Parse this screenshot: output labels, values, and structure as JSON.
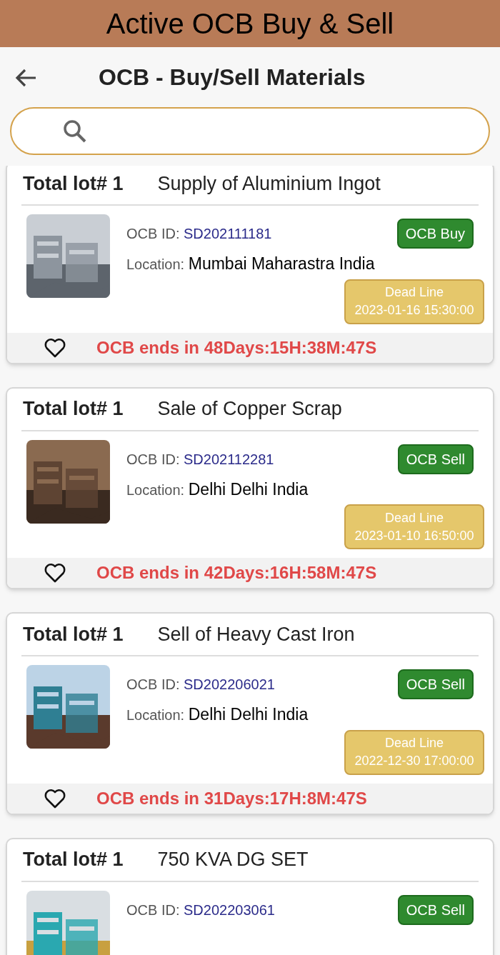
{
  "banner": {
    "title": "Active OCB Buy & Sell"
  },
  "app_bar": {
    "title": "OCB - Buy/Sell Materials"
  },
  "lots": [
    {
      "lot": "Total lot# 1",
      "name": "Supply of Aluminium Ingot",
      "id_label": "OCB ID:",
      "id": "SD202111181",
      "location_label": "Location:",
      "location": "Mumbai Maharastra India",
      "type": "OCB Buy",
      "deadline_label": "Dead Line",
      "deadline": "2023-01-16 15:30:00",
      "countdown": "OCB ends in 48Days:15H:38M:47S",
      "favorite": false
    },
    {
      "lot": "Total lot# 1",
      "name": "Sale of Copper Scrap",
      "id_label": "OCB ID:",
      "id": "SD202112281",
      "location_label": "Location:",
      "location": "Delhi Delhi India",
      "type": "OCB Sell",
      "deadline_label": "Dead Line",
      "deadline": "2023-01-10 16:50:00",
      "countdown": "OCB ends in 42Days:16H:58M:47S",
      "favorite": false
    },
    {
      "lot": "Total lot# 1",
      "name": "Sell of Heavy Cast Iron",
      "id_label": "OCB ID:",
      "id": "SD202206021",
      "location_label": "Location:",
      "location": "Delhi Delhi India",
      "type": "OCB Sell",
      "deadline_label": "Dead Line",
      "deadline": "2022-12-30 17:00:00",
      "countdown": "OCB ends in 31Days:17H:8M:47S",
      "favorite": false
    },
    {
      "lot": "Total lot# 1",
      "name": "750 KVA DG SET",
      "id_label": "OCB ID:",
      "id": "SD202203061",
      "type": "OCB Sell"
    }
  ]
}
